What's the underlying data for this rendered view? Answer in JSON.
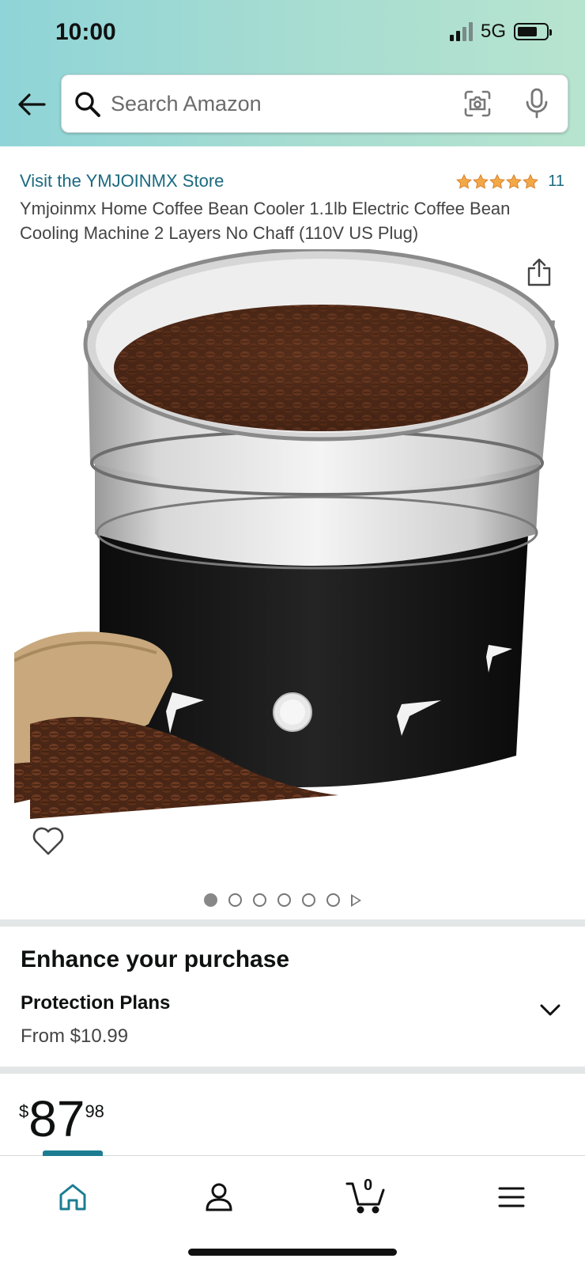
{
  "status_bar": {
    "time": "10:00",
    "network": "5G"
  },
  "search": {
    "placeholder": "Search Amazon"
  },
  "product": {
    "store_link": "Visit the YMJOINMX Store",
    "rating_stars": 5,
    "rating_count": "11",
    "title": "Ymjoinmx Home Coffee Bean Cooler 1.1lb Electric Coffee Bean Cooling Machine 2 Layers No Chaff (110V US Plug)"
  },
  "gallery": {
    "image_count": 6,
    "active_index": 0
  },
  "enhance": {
    "title": "Enhance your purchase",
    "plan_title": "Protection Plans",
    "plan_price": "From $10.99"
  },
  "price": {
    "symbol": "$",
    "whole": "87",
    "fraction": "98"
  },
  "nav": {
    "cart_count": "0",
    "active": "home"
  },
  "colors": {
    "link": "#1b6a80",
    "star": "#f3a847",
    "accent": "#1c7d92"
  }
}
